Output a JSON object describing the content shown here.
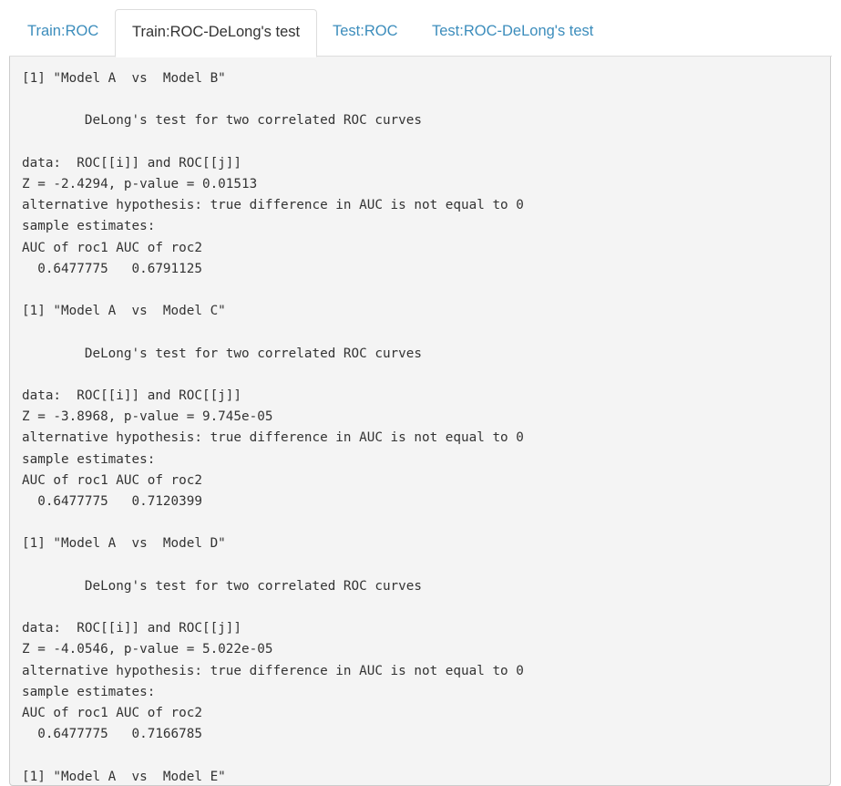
{
  "tabs": [
    {
      "label": "Train:ROC",
      "active": false
    },
    {
      "label": "Train:ROC-DeLong's test",
      "active": true
    },
    {
      "label": "Test:ROC",
      "active": false
    },
    {
      "label": "Test:ROC-DeLong's test",
      "active": false
    }
  ],
  "output": {
    "lines": [
      "[1] \"Model A  vs  Model B\"",
      "",
      "        DeLong's test for two correlated ROC curves",
      "",
      "data:  ROC[[i]] and ROC[[j]]",
      "Z = -2.4294, p-value = 0.01513",
      "alternative hypothesis: true difference in AUC is not equal to 0",
      "sample estimates:",
      "AUC of roc1 AUC of roc2",
      "  0.6477775   0.6791125",
      "",
      "[1] \"Model A  vs  Model C\"",
      "",
      "        DeLong's test for two correlated ROC curves",
      "",
      "data:  ROC[[i]] and ROC[[j]]",
      "Z = -3.8968, p-value = 9.745e-05",
      "alternative hypothesis: true difference in AUC is not equal to 0",
      "sample estimates:",
      "AUC of roc1 AUC of roc2",
      "  0.6477775   0.7120399",
      "",
      "[1] \"Model A  vs  Model D\"",
      "",
      "        DeLong's test for two correlated ROC curves",
      "",
      "data:  ROC[[i]] and ROC[[j]]",
      "Z = -4.0546, p-value = 5.022e-05",
      "alternative hypothesis: true difference in AUC is not equal to 0",
      "sample estimates:",
      "AUC of roc1 AUC of roc2",
      "  0.6477775   0.7166785",
      "",
      "[1] \"Model A  vs  Model E\""
    ]
  }
}
